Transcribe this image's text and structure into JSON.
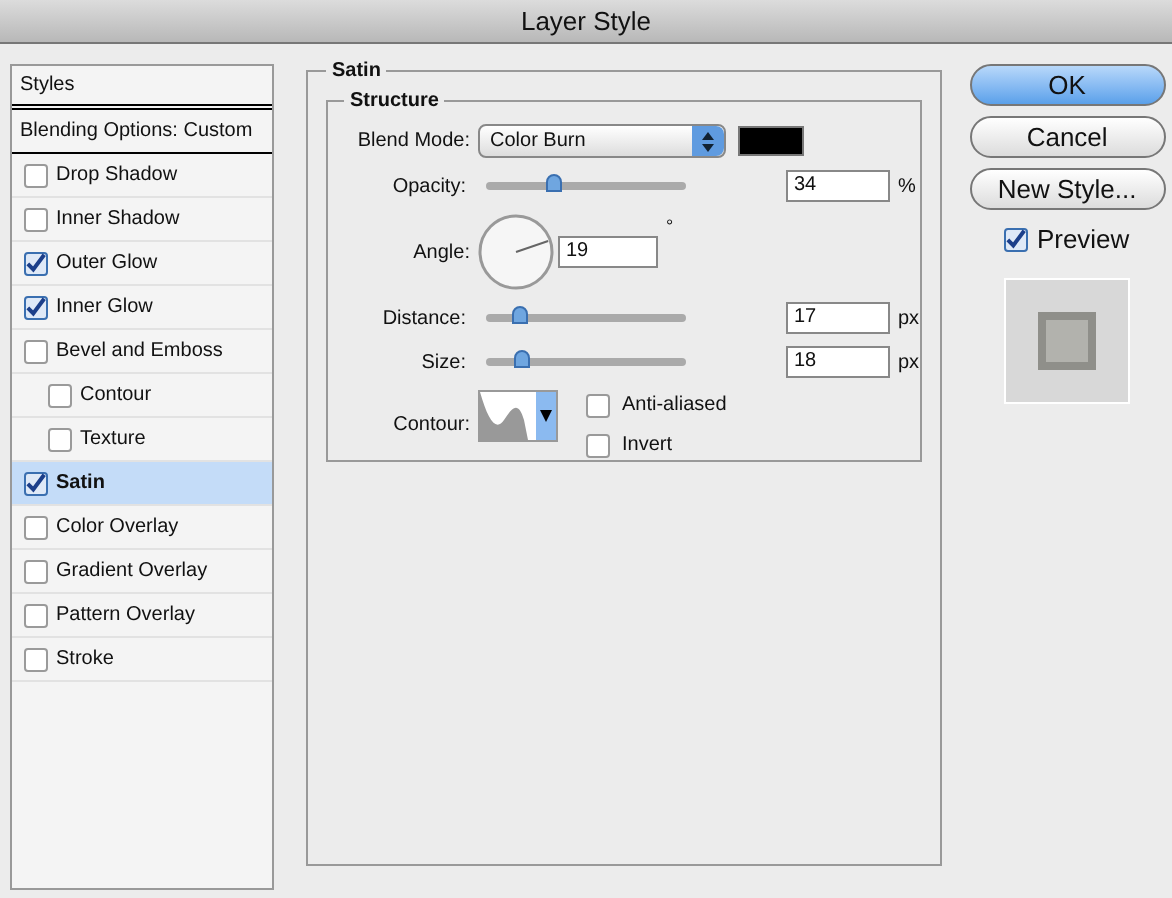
{
  "window": {
    "title": "Layer Style"
  },
  "sidebar": {
    "header": "Styles",
    "blending": {
      "label": "Blending Options: Custom",
      "selected": false
    },
    "items": [
      {
        "label": "Drop Shadow",
        "checked": false,
        "selected": false
      },
      {
        "label": "Inner Shadow",
        "checked": false,
        "selected": false
      },
      {
        "label": "Outer Glow",
        "checked": true,
        "selected": false
      },
      {
        "label": "Inner Glow",
        "checked": true,
        "selected": false
      },
      {
        "label": "Bevel and Emboss",
        "checked": false,
        "selected": false,
        "children": [
          {
            "label": "Contour",
            "checked": false,
            "selected": false
          },
          {
            "label": "Texture",
            "checked": false,
            "selected": false
          }
        ]
      },
      {
        "label": "Satin",
        "checked": true,
        "selected": true
      },
      {
        "label": "Color Overlay",
        "checked": false,
        "selected": false
      },
      {
        "label": "Gradient Overlay",
        "checked": false,
        "selected": false
      },
      {
        "label": "Pattern Overlay",
        "checked": false,
        "selected": false
      },
      {
        "label": "Stroke",
        "checked": false,
        "selected": false
      }
    ]
  },
  "panel": {
    "title": "Satin",
    "group": "Structure",
    "blend_mode": {
      "label": "Blend Mode:",
      "value": "Color Burn",
      "color": "#000000"
    },
    "opacity": {
      "label": "Opacity:",
      "level": 0.34,
      "value": "34",
      "unit": "%"
    },
    "angle": {
      "label": "Angle:",
      "value": "19",
      "unit": "°"
    },
    "distance": {
      "label": "Distance:",
      "level": 0.17,
      "value": "17",
      "unit": "px"
    },
    "size": {
      "label": "Size:",
      "level": 0.18,
      "value": "18",
      "unit": "px"
    },
    "contour": {
      "label": "Contour:"
    },
    "options": [
      {
        "label": "Anti-aliased",
        "checked": false
      },
      {
        "label": "Invert",
        "checked": false
      }
    ]
  },
  "buttons": [
    {
      "label": "OK",
      "kind": "default"
    },
    {
      "label": "Cancel",
      "kind": "normal"
    },
    {
      "label": "New Style...",
      "kind": "normal"
    }
  ],
  "preview": {
    "label": "Preview",
    "checked": true
  }
}
